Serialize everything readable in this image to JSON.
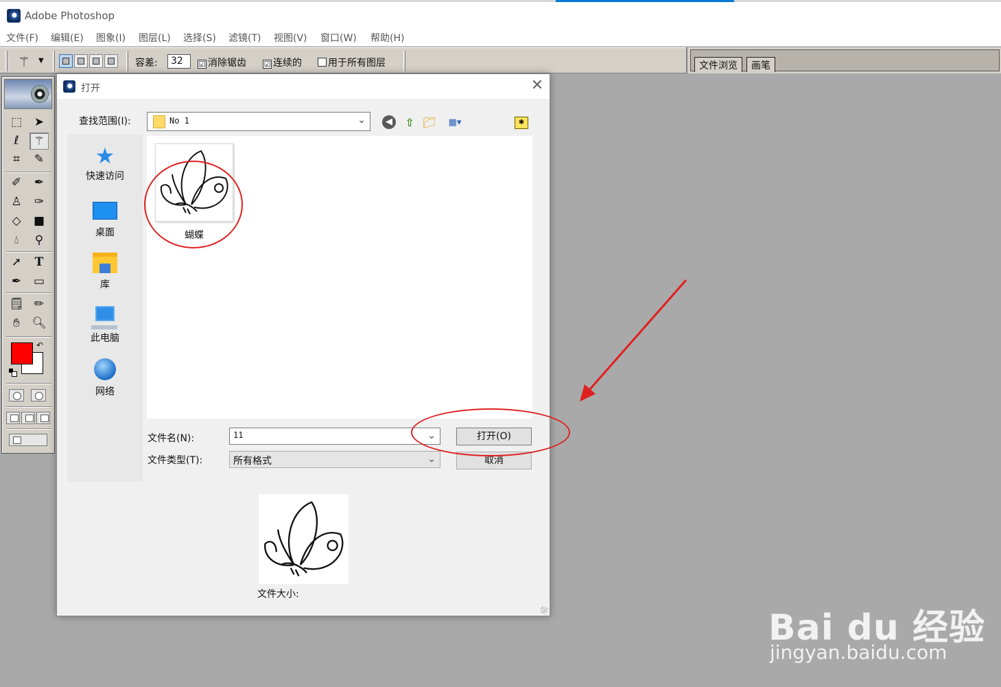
{
  "app": {
    "title": "Adobe Photoshop"
  },
  "menu": [
    "文件(F)",
    "编辑(E)",
    "图象(I)",
    "图层(L)",
    "选择(S)",
    "滤镜(T)",
    "视图(V)",
    "窗口(W)",
    "帮助(H)"
  ],
  "options": {
    "tolerance_label": "容差:",
    "tolerance_value": "32",
    "antialias_label": "消除锯齿",
    "antialias_checked": "☑",
    "contiguous_label": "连续的",
    "contiguous_checked": "☑",
    "all_layers_label": "用于所有图层",
    "all_layers_checked": ""
  },
  "palette_well": {
    "tabs": [
      "文件浏览",
      "画笔"
    ]
  },
  "toolbox": {
    "foreground_color": "#fe0000",
    "background_color": "#ffffff",
    "tools": [
      "rectangular-marquee-icon",
      "move-icon",
      "lasso-icon",
      "magic-wand-icon",
      "crop-icon",
      "slice-icon",
      "healing-brush-icon",
      "brush-icon",
      "clone-stamp-icon",
      "history-brush-icon",
      "eraser-icon",
      "gradient-icon",
      "blur-icon",
      "dodge-icon",
      "path-selection-icon",
      "type-icon",
      "pen-icon",
      "rectangle-shape-icon",
      "notes-icon",
      "eyedropper-icon",
      "hand-icon",
      "zoom-icon"
    ]
  },
  "dialog": {
    "title": "打开",
    "look_in_label": "查找范围(I):",
    "look_in_value": "No 1",
    "places": [
      "快速访问",
      "桌面",
      "库",
      "此电脑",
      "网络"
    ],
    "files": [
      {
        "name": "蝴蝶"
      }
    ],
    "filename_label": "文件名(N):",
    "filename_value": "11",
    "filetype_label": "文件类型(T):",
    "filetype_value": "所有格式",
    "open_button": "打开(O)",
    "cancel_button": "取消",
    "file_size_label": "文件大小:"
  },
  "annotation": {
    "color": "#e01f1f"
  },
  "watermark": {
    "brand": "Bai du 经验",
    "url": "jingyan.baidu.com"
  }
}
